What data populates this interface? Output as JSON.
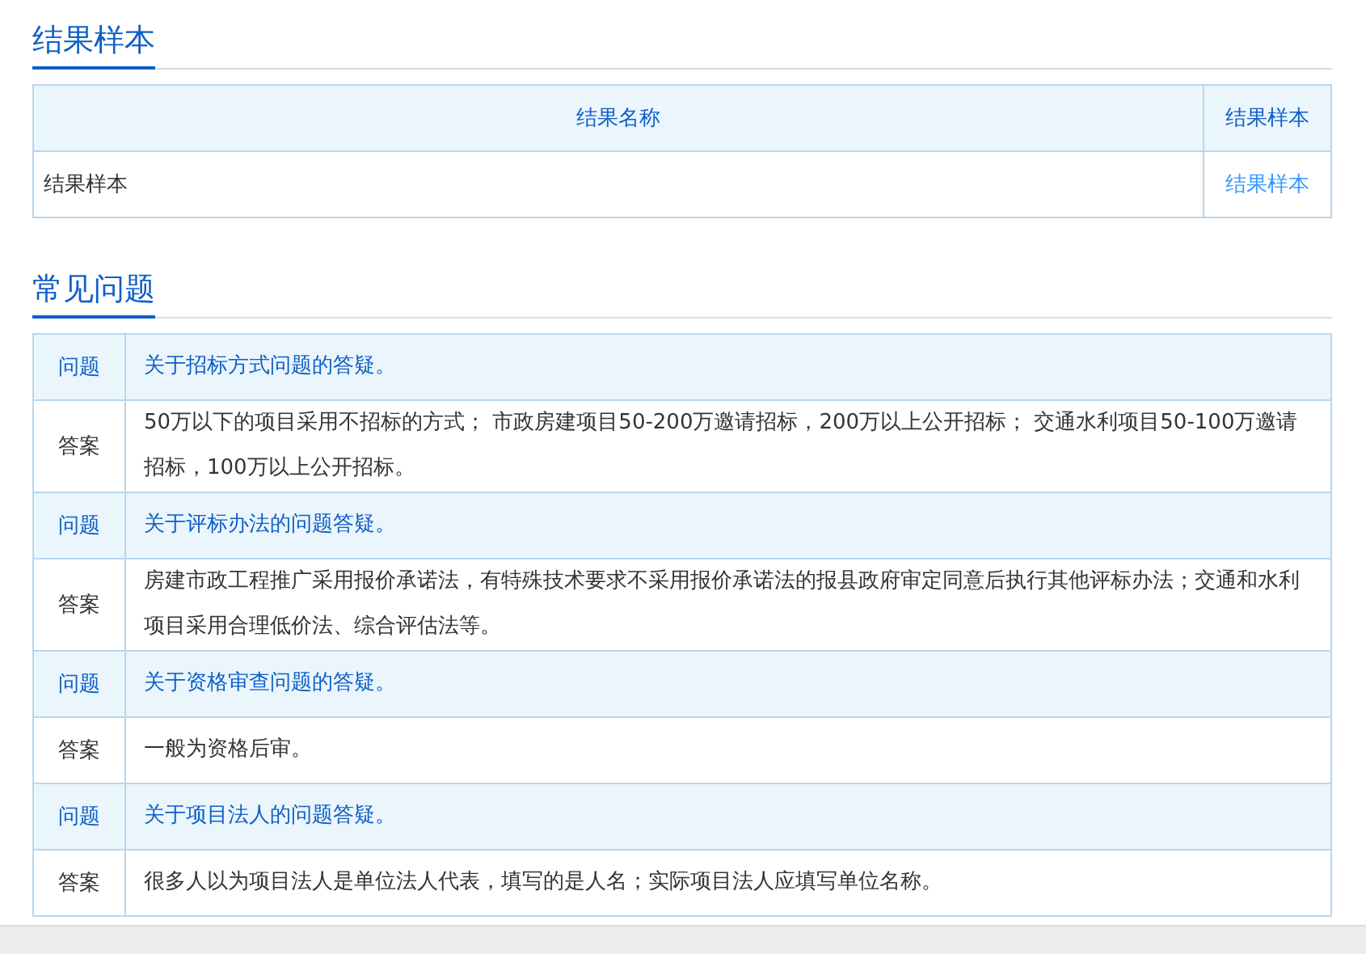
{
  "sample_section": {
    "title": "结果样本",
    "table": {
      "columns": [
        "结果名称",
        "结果样本"
      ],
      "rows": [
        {
          "name": "结果样本",
          "link": "结果样本"
        }
      ]
    }
  },
  "faq_section": {
    "title": "常见问题",
    "items": [
      {
        "q_label": "问题",
        "question": "关于招标方式问题的答疑。",
        "a_label": "答案",
        "answer": "50万以下的项目采用不招标的方式； 市政房建项目50-200万邀请招标，200万以上公开招标； 交通水利项目50-100万邀请招标，100万以上公开招标。"
      },
      {
        "q_label": "问题",
        "question": "关于评标办法的问题答疑。",
        "a_label": "答案",
        "answer": "房建市政工程推广采用报价承诺法，有特殊技术要求不采用报价承诺法的报县政府审定同意后执行其他评标办法；交通和水利项目采用合理低价法、综合评估法等。"
      },
      {
        "q_label": "问题",
        "question": "关于资格审查问题的答疑。",
        "a_label": "答案",
        "answer": "一般为资格后审。"
      },
      {
        "q_label": "问题",
        "question": "关于项目法人的问题答疑。",
        "a_label": "答案",
        "answer": "很多人以为项目法人是单位法人代表，填写的是人名；实际项目法人应填写单位名称。"
      }
    ]
  }
}
